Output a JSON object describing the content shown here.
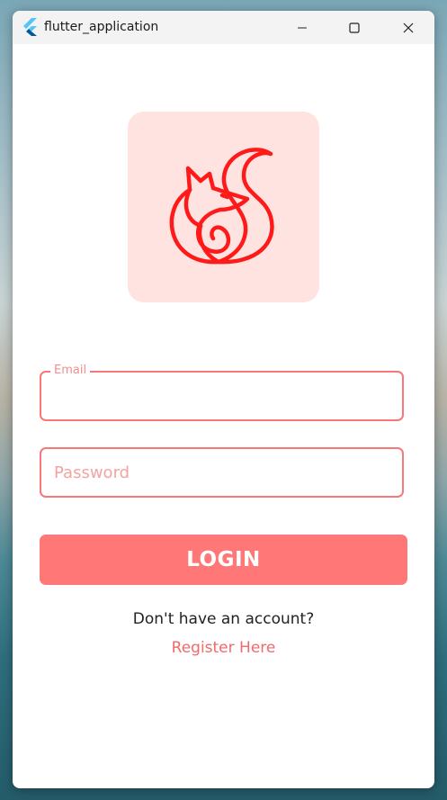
{
  "window": {
    "title": "flutter_application",
    "icon": "flutter-icon"
  },
  "window_controls": {
    "minimize_icon": "minimize-icon",
    "maximize_icon": "maximize-icon",
    "close_icon": "close-icon"
  },
  "logo": {
    "icon": "fox-icon",
    "background_color": "#ffe3e1",
    "stroke_color": "#ff1a1a"
  },
  "form": {
    "email": {
      "label": "Email",
      "value": ""
    },
    "password": {
      "placeholder": "Password",
      "value": ""
    },
    "login_label": "LOGIN"
  },
  "footer": {
    "prompt": "Don't have an account?",
    "register_link": "Register Here"
  },
  "colors": {
    "accent": "#ff7777",
    "field_border": "#f7777a",
    "link": "#f06a6a"
  }
}
